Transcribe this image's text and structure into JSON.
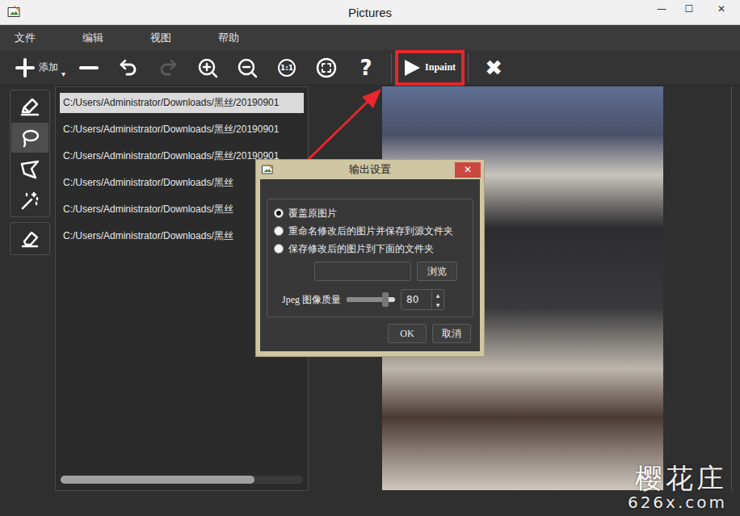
{
  "window": {
    "title": "Pictures",
    "controls": [
      "—",
      "☐",
      "✕"
    ]
  },
  "menu": [
    "文件",
    "编辑",
    "视图",
    "帮助"
  ],
  "toolbar": [
    {
      "kind": "add",
      "label": "添加",
      "caret": "▾",
      "disabled": false,
      "highlighted": false
    },
    {
      "kind": "remove",
      "disabled": false,
      "highlighted": false
    },
    {
      "kind": "undo",
      "disabled": false,
      "highlighted": false
    },
    {
      "kind": "redo",
      "disabled": true,
      "highlighted": false
    },
    {
      "kind": "zoom-in",
      "disabled": false,
      "highlighted": false
    },
    {
      "kind": "zoom-out",
      "disabled": false,
      "highlighted": false
    },
    {
      "kind": "actual-size",
      "text": "1:1",
      "disabled": false,
      "highlighted": false
    },
    {
      "kind": "fit",
      "disabled": false,
      "highlighted": false
    },
    {
      "kind": "help",
      "text": "?",
      "disabled": false,
      "highlighted": false
    },
    {
      "kind": "separator"
    },
    {
      "kind": "run",
      "label": "Inpaint",
      "disabled": false,
      "highlighted": true
    },
    {
      "kind": "separator"
    },
    {
      "kind": "close",
      "text": "✖",
      "disabled": false,
      "highlighted": false
    }
  ],
  "tools": [
    [
      {
        "kind": "brush",
        "selected": false
      },
      {
        "kind": "lasso",
        "selected": true
      },
      {
        "kind": "polygon",
        "selected": false
      },
      {
        "kind": "wand",
        "selected": false
      }
    ],
    [
      {
        "kind": "eraser",
        "selected": false
      }
    ]
  ],
  "files": {
    "items": [
      {
        "path": "C:/Users/Administrator/Downloads/黑丝/20190901",
        "selected": true
      },
      {
        "path": "C:/Users/Administrator/Downloads/黑丝/20190901",
        "selected": false
      },
      {
        "path": "C:/Users/Administrator/Downloads/黑丝/20190901",
        "selected": false
      },
      {
        "path": "C:/Users/Administrator/Downloads/黑丝",
        "selected": false
      },
      {
        "path": "C:/Users/Administrator/Downloads/黑丝",
        "selected": false
      },
      {
        "path": "C:/Users/Administrator/Downloads/黑丝",
        "selected": false
      }
    ],
    "scrollbar": {
      "level": 0.8
    }
  },
  "dialog": {
    "title": "输出设置",
    "close": "✕",
    "options": [
      {
        "label": "覆盖原图片",
        "selected": true
      },
      {
        "label": "重命名修改后的图片并保存到源文件夹",
        "selected": false
      },
      {
        "label": "保存修改后的图片到下面的文件夹",
        "selected": false
      }
    ],
    "folder": {
      "value": ""
    },
    "browse": "浏览",
    "quality": {
      "label": "Jpeg 图像质量",
      "level": 0.8,
      "value": "80",
      "up": "▲",
      "down": "▼"
    },
    "buttons": [
      "OK",
      "取消"
    ]
  },
  "watermark": {
    "title": "樱花庄",
    "url": "626x.com"
  }
}
